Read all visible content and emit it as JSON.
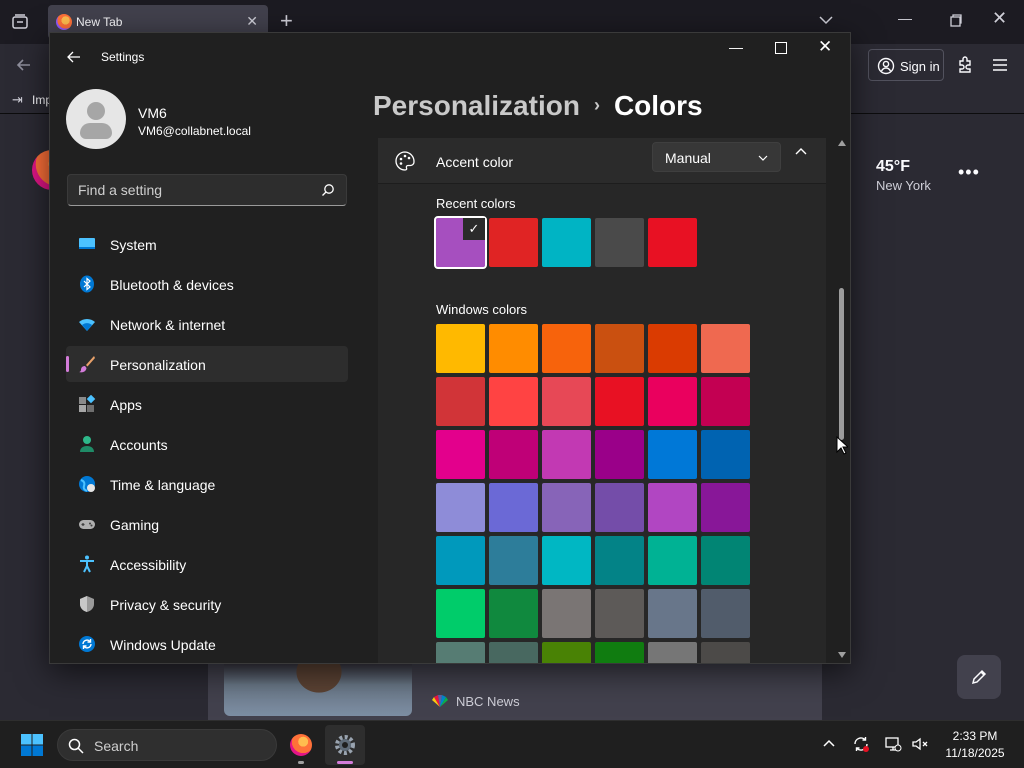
{
  "firefox": {
    "tab_title": "New Tab",
    "sign_in_label": "Sign in",
    "bookmark_label": "Imp",
    "weather_temp": "45°F",
    "weather_city": "New York",
    "story_source": "NBC News"
  },
  "settings": {
    "window_title": "Settings",
    "user": {
      "name": "VM6",
      "email": "VM6@collabnet.local"
    },
    "search_placeholder": "Find a setting",
    "nav": [
      {
        "label": "System",
        "icon": "system-icon"
      },
      {
        "label": "Bluetooth & devices",
        "icon": "bluetooth-icon"
      },
      {
        "label": "Network & internet",
        "icon": "network-icon"
      },
      {
        "label": "Personalization",
        "icon": "paintbrush-icon",
        "active": true
      },
      {
        "label": "Apps",
        "icon": "apps-icon"
      },
      {
        "label": "Accounts",
        "icon": "accounts-icon"
      },
      {
        "label": "Time & language",
        "icon": "time-language-icon"
      },
      {
        "label": "Gaming",
        "icon": "gaming-icon"
      },
      {
        "label": "Accessibility",
        "icon": "accessibility-icon"
      },
      {
        "label": "Privacy & security",
        "icon": "shield-icon"
      },
      {
        "label": "Windows Update",
        "icon": "windows-update-icon"
      }
    ],
    "breadcrumb": {
      "parent": "Personalization",
      "separator": "›",
      "current": "Colors"
    },
    "accent_color": {
      "label": "Accent color",
      "mode": "Manual"
    },
    "recent_colors_label": "Recent colors",
    "recent_colors": [
      "#a64fbf",
      "#e02424",
      "#00b4c4",
      "#4a4a4a",
      "#e81123"
    ],
    "selected_recent_index": 0,
    "windows_colors_label": "Windows colors",
    "windows_colors": [
      [
        "#ffb900",
        "#ff8c00",
        "#f7630c",
        "#ca5010",
        "#da3b01",
        "#ef6950"
      ],
      [
        "#d13438",
        "#ff4343",
        "#e74856",
        "#e81123",
        "#ea005e",
        "#c30052"
      ],
      [
        "#e3008c",
        "#bf0077",
        "#c239b3",
        "#9a0089",
        "#0078d7",
        "#0063b1"
      ],
      [
        "#8e8cd8",
        "#6b69d6",
        "#8764b8",
        "#744da9",
        "#b146c2",
        "#881798"
      ],
      [
        "#0099bc",
        "#2d7d9a",
        "#00b7c3",
        "#038387",
        "#00b294",
        "#018574"
      ],
      [
        "#00cc6a",
        "#10893e",
        "#7a7574",
        "#5d5a58",
        "#68768a",
        "#515c6b"
      ],
      [
        "#567c73",
        "#486860",
        "#498205",
        "#107c10",
        "#767676",
        "#4c4a48"
      ]
    ]
  },
  "taskbar": {
    "search_label": "Search",
    "time": "2:33 PM",
    "date": "11/18/2025"
  },
  "colors": {
    "accent": "#d37cd9",
    "settings_bg": "#202020",
    "content_bg": "#272727"
  }
}
